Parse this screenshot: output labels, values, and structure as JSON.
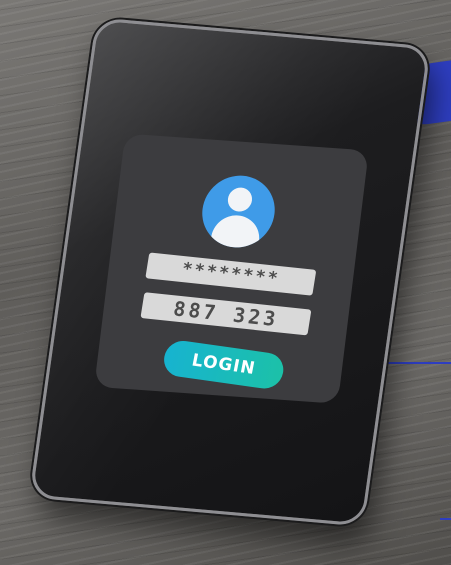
{
  "login_form": {
    "password_masked": "********",
    "code_value": "887 323",
    "login_label": "LOGIN"
  },
  "icons": {
    "avatar": "user-avatar-icon"
  },
  "colors": {
    "avatar_bg": "#3f9be8",
    "button_gradient_start": "#17b3d0",
    "button_gradient_end": "#1cc1a8",
    "accent": "#2e3ec0"
  }
}
